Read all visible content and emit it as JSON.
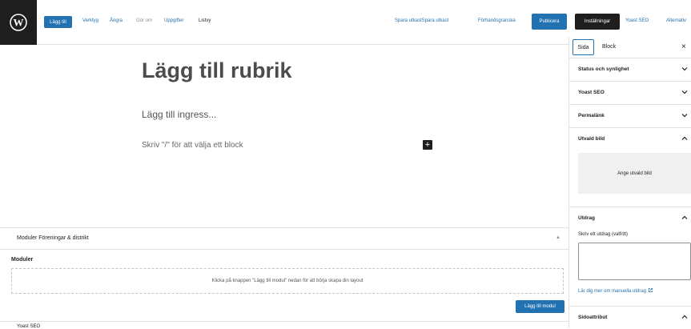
{
  "toolbar": {
    "add_button": "Lägg till",
    "tools": "Verktyg",
    "undo": "Ångra",
    "redo": "Gör om",
    "details": "Uppgifter",
    "list_view": "Listvy",
    "save_draft": "Spara utkastSpara utkast",
    "preview": "Förhandsgranska",
    "publish": "Publicera",
    "settings": "Inställningar",
    "yoast": "Yoast SEO",
    "more": "Alternativ"
  },
  "editor": {
    "title_placeholder": "Lägg till rubrik",
    "lead_placeholder": "Lägg till ingress...",
    "block_hint": "Skriv \"/\" för att välja ett block",
    "add_block": "+"
  },
  "metabox": {
    "title": "Moduler Föreningar & distrikt",
    "toggle": "▲",
    "modules_label": "Moduler",
    "dropzone_text": "Klicka på knappen \"Lägg till modul\" nedan för att börja skapa din layout",
    "add_module": "Lägg till modul",
    "next_box_title": "Yoast SEO"
  },
  "sidebar": {
    "tab_page": "Sida",
    "tab_block": "Block",
    "close": "×",
    "panels": [
      {
        "label": "Status och synlighet",
        "state": "collapsed"
      },
      {
        "label": "Yoast SEO",
        "state": "collapsed"
      },
      {
        "label": "Permalänk",
        "state": "collapsed"
      },
      {
        "label": "Utvald bild",
        "state": "expanded"
      },
      {
        "label": "Utdrag",
        "state": "expanded"
      },
      {
        "label": "Sidoattribut",
        "state": "expanded"
      }
    ],
    "featured_image_button": "Ange utvald bild",
    "excerpt_label": "Skriv ett utdrag (valfritt)",
    "excerpt_link": "Lär dig mer om manuella utdrag"
  },
  "colors": {
    "accent": "#2271b1",
    "dark": "#1e1e1e",
    "border": "#e0e0e0"
  },
  "icons": {
    "logo": "wordpress-logo-icon",
    "close": "close-icon",
    "chevron_down": "chevron-down-icon",
    "chevron_up": "chevron-up-icon",
    "external": "external-link-icon"
  }
}
